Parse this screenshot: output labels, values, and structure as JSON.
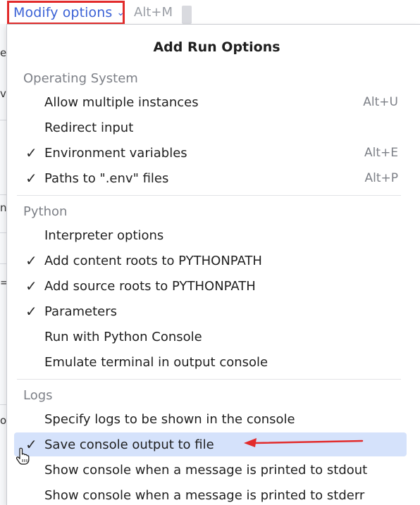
{
  "toolbar": {
    "modify_label": "Modify options",
    "modify_shortcut": "Alt+M"
  },
  "popup": {
    "title": "Add Run Options",
    "sections": [
      {
        "header": "Operating System",
        "items": [
          {
            "label": "Allow multiple instances",
            "checked": false,
            "shortcut": "Alt+U"
          },
          {
            "label": "Redirect input",
            "checked": false,
            "shortcut": ""
          },
          {
            "label": "Environment variables",
            "checked": true,
            "shortcut": "Alt+E"
          },
          {
            "label": "Paths to \".env\" files",
            "checked": true,
            "shortcut": "Alt+P"
          }
        ]
      },
      {
        "header": "Python",
        "items": [
          {
            "label": "Interpreter options",
            "checked": false,
            "shortcut": ""
          },
          {
            "label": "Add content roots to PYTHONPATH",
            "checked": true,
            "shortcut": ""
          },
          {
            "label": "Add source roots to PYTHONPATH",
            "checked": true,
            "shortcut": ""
          },
          {
            "label": "Parameters",
            "checked": true,
            "shortcut": ""
          },
          {
            "label": "Run with Python Console",
            "checked": false,
            "shortcut": ""
          },
          {
            "label": "Emulate terminal in output console",
            "checked": false,
            "shortcut": ""
          }
        ]
      },
      {
        "header": "Logs",
        "items": [
          {
            "label": "Specify logs to be shown in the console",
            "checked": false,
            "shortcut": ""
          },
          {
            "label": "Save console output to file",
            "checked": true,
            "shortcut": "",
            "selected": true
          },
          {
            "label": "Show console when a message is printed to stdout",
            "checked": false,
            "shortcut": ""
          },
          {
            "label": "Show console when a message is printed to stderr",
            "checked": false,
            "shortcut": ""
          }
        ]
      }
    ]
  },
  "glyphs": {
    "check": "✓",
    "chevron_down": "⌄"
  },
  "background_fragments": [
    "er",
    "v",
    "n",
    "=",
    "o"
  ],
  "colors": {
    "accent_link": "#3b62d6",
    "highlight_border": "#e22b2b",
    "selected_row": "#d5e2fb",
    "arrow": "#e22b2b"
  }
}
